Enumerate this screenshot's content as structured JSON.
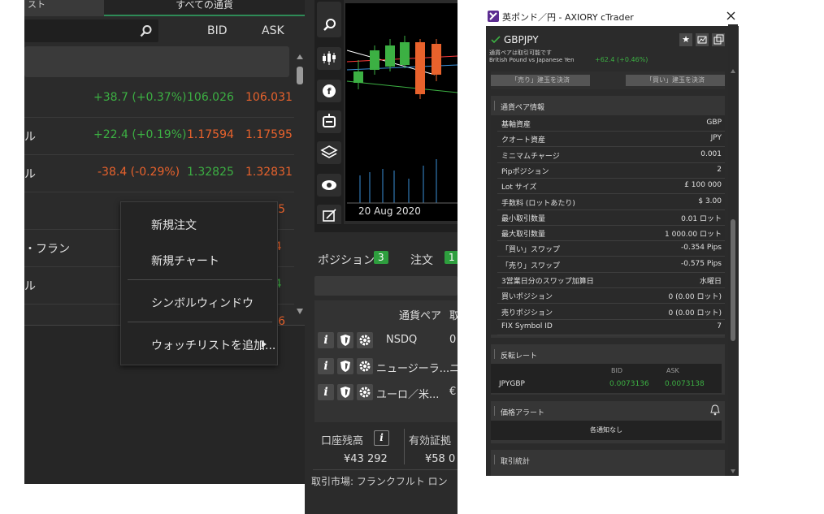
{
  "watchlist": {
    "tab_left": "スト",
    "tab_all": "すべての通貨",
    "columns": {
      "bid": "BID",
      "ask": "ASK"
    },
    "rows": [
      {
        "symbol": "",
        "change": "+38.7 (+0.37%)",
        "bid": "106.026",
        "ask": "106.031",
        "bid_color": "#3cb043",
        "ask_color": "#e8622c"
      },
      {
        "symbol": "ル",
        "change": "+22.4 (+0.19%)",
        "bid": "1.17594",
        "ask": "1.17595",
        "bid_color": "#e8622c",
        "ask_color": "#e8622c"
      },
      {
        "symbol": "ル",
        "change": "-38.4 (-0.29%)",
        "bid": "1.32825",
        "ask": "1.32831",
        "bid_color": "#3cb043",
        "ask_color": "#e8622c"
      },
      {
        "symbol": "",
        "change": "",
        "bid": "",
        "ask": "36.605",
        "bid_color": "#3cb043",
        "ask_color": "#e8622c"
      },
      {
        "symbol": "・フラン",
        "change": "",
        "bid": "",
        "ask": "07844",
        "bid_color": "#3cb043",
        "ask_color": "#e8622c"
      },
      {
        "symbol": "ル",
        "change": "",
        "bid": "",
        "ask": "64784",
        "bid_color": "#3cb043",
        "ask_color": "#3cb043"
      },
      {
        "symbol": "",
        "change": "",
        "bid": "",
        "ask": "79.826",
        "bid_color": "#3cb043",
        "ask_color": "#e8622c"
      }
    ],
    "context_menu": [
      "新規注文",
      "新規チャート",
      "シンボルウィンドウ",
      "ウォッチリストを追加..."
    ]
  },
  "chart": {
    "date_label": "20 Aug 2020"
  },
  "positions": {
    "tab_positions": "ポジション",
    "positions_count": "3",
    "tab_orders": "注文",
    "orders_count": "1",
    "col_pair": "通貨ペア",
    "col_trunc": "取",
    "rows": [
      {
        "name": "NSDQ",
        "extra": "0"
      },
      {
        "name": "ニュージーラ...",
        "extra": "ニ"
      },
      {
        "name": "ユーロ／米...",
        "extra": "€"
      }
    ],
    "balance_label": "口座残高",
    "balance_value": "¥43 292",
    "equity_label": "有効証拠",
    "equity_value": "¥58 0",
    "bottom_text": "取引市場: フランクフルト ロン"
  },
  "symbol_window": {
    "title": "英ポンド／円 - AXIORY cTrader",
    "symbol": "GBPJPY",
    "tradable_note": "通貨ペアは取引可能です",
    "description": "British Pound vs Japanese Yen",
    "change": "+62.4 (+0.46%)",
    "sell_close": "「売り」建玉を決済",
    "buy_close": "「買い」建玉を決済",
    "info_header": "通貨ペア情報",
    "info": [
      {
        "k": "基軸資産",
        "v": "GBP"
      },
      {
        "k": "クオート資産",
        "v": "JPY"
      },
      {
        "k": "ミニマムチャージ",
        "v": "0.001"
      },
      {
        "k": "Pipポジション",
        "v": "2"
      },
      {
        "k": "Lot サイズ",
        "v": "£ 100 000"
      },
      {
        "k": "手数料 (ロットあたり)",
        "v": "$ 3.00"
      },
      {
        "k": "最小取引数量",
        "v": "0.01 ロット"
      },
      {
        "k": "最大取引数量",
        "v": "1 000.00 ロット"
      },
      {
        "k": "「買い」スワップ",
        "v": "-0.354 Pips"
      },
      {
        "k": "「売り」スワップ",
        "v": "-0.575 Pips"
      },
      {
        "k": "3営業日分のスワップ加算日",
        "v": "水曜日"
      },
      {
        "k": "買いポジション",
        "v": "0 (0.00 ロット)"
      },
      {
        "k": "売りポジション",
        "v": "0 (0.00 ロット)"
      },
      {
        "k": "FIX Symbol ID",
        "v": "7"
      }
    ],
    "reverse_header": "反転レート",
    "reverse_bid_label": "BID",
    "reverse_ask_label": "ASK",
    "reverse_symbol": "JPYGBP",
    "reverse_bid": "0.0073136",
    "reverse_ask": "0.0073138",
    "alert_header": "価格アラート",
    "alert_empty": "各通知なし",
    "stats_header": "取引統計"
  }
}
